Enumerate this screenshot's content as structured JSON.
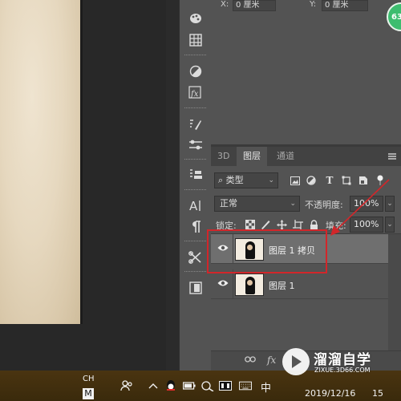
{
  "properties": {
    "x_label": "X:",
    "x_value": "0 厘米",
    "y_label": "Y:",
    "y_value": "0 厘米",
    "badge": "63"
  },
  "tabs": [
    {
      "label": "3D",
      "active": false
    },
    {
      "label": "图层",
      "active": true
    },
    {
      "label": "通道",
      "active": false
    }
  ],
  "filter": {
    "kind_label": "类型",
    "icons": [
      "image-filter-icon",
      "adjustment-filter-icon",
      "type-filter-icon",
      "shape-filter-icon",
      "smart-object-filter-icon",
      "filter-toggle-icon"
    ]
  },
  "blend": {
    "mode": "正常",
    "opacity_label": "不透明度:",
    "opacity_value": "100%"
  },
  "lock": {
    "label": "锁定:",
    "fill_label": "填充:",
    "fill_value": "100%"
  },
  "layers": [
    {
      "name": "图层 1 拷贝",
      "selected": true,
      "visible": true
    },
    {
      "name": "图层 1",
      "selected": false,
      "visible": true
    }
  ],
  "footer": {
    "link_icon": "link-icon",
    "fx_label": "fx"
  },
  "taskbar": {
    "input_lang": "CH",
    "input_mode": "M",
    "ime": "中",
    "date": "2019/12/16",
    "clock_fragment": "15"
  },
  "watermark": {
    "title": "溜溜自学",
    "subtitle": "ZIXUE.3D66.COM"
  },
  "colors": {
    "panel": "#535353",
    "selected_layer": "#6f6f6f",
    "annotation": "#d2262a",
    "badge": "#3dbd6f"
  }
}
